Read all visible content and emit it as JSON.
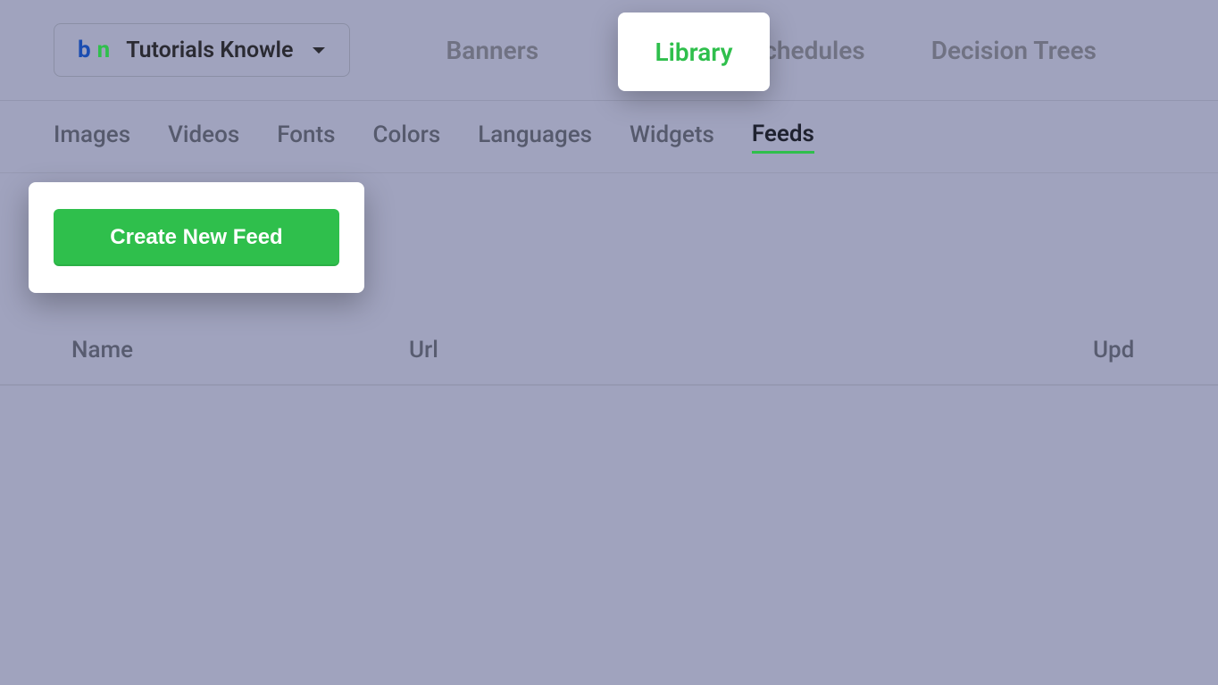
{
  "workspace": {
    "logo_b": "b",
    "logo_n": "n",
    "name": "Tutorials Knowle"
  },
  "main_nav": {
    "banners": "Banners",
    "library": "Library",
    "schedules": "Schedules",
    "decision_trees": "Decision Trees"
  },
  "sub_nav": {
    "images": "Images",
    "videos": "Videos",
    "fonts": "Fonts",
    "colors": "Colors",
    "languages": "Languages",
    "widgets": "Widgets",
    "feeds": "Feeds"
  },
  "actions": {
    "create_feed": "Create New Feed"
  },
  "table": {
    "col_name": "Name",
    "col_url": "Url",
    "col_updated": "Upd"
  }
}
